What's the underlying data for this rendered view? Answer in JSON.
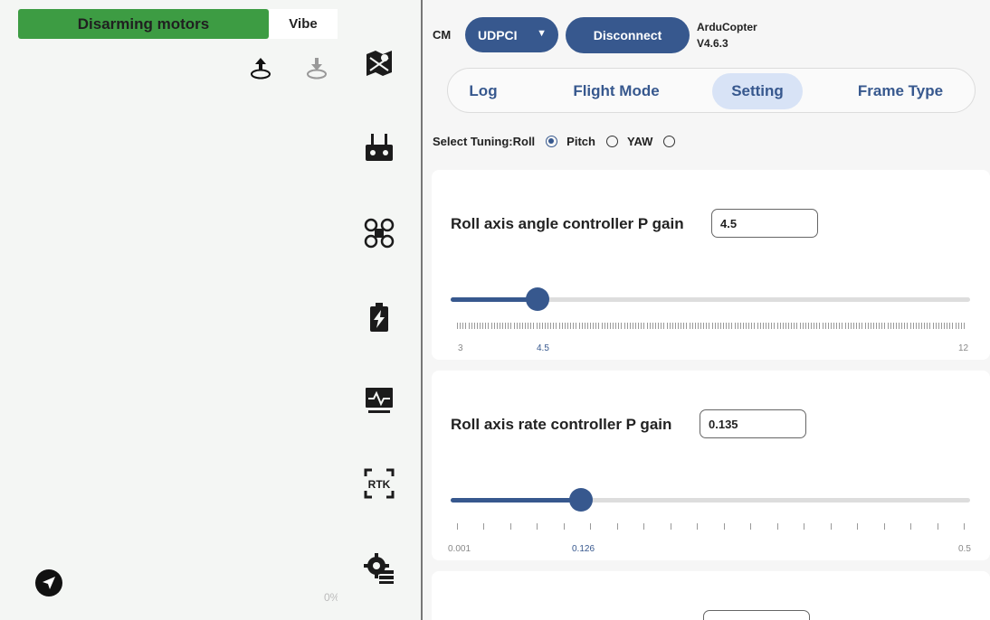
{
  "left_panel": {
    "status_label": "Disarming motors",
    "vibe_label": "Vibe",
    "percent_text": "0%",
    "icons": [
      "upload-mission-icon",
      "download-mission-icon",
      "send-icon"
    ]
  },
  "rail": {
    "icons": [
      "map-icon",
      "remote-controller-icon",
      "drone-frame-icon",
      "battery-icon",
      "monitor-icon",
      "rtk-icon",
      "settings-icon"
    ],
    "rtk_text": "RTK"
  },
  "header": {
    "cm_label": "CM",
    "connection_select": "UDPCI",
    "disconnect_label": "Disconnect",
    "firmware_name": "ArduCopter",
    "firmware_version": "V4.6.3"
  },
  "tabs": [
    {
      "label": "Log",
      "active": false
    },
    {
      "label": "Flight Mode",
      "active": false
    },
    {
      "label": "Setting",
      "active": true
    },
    {
      "label": "Frame Type",
      "active": false
    }
  ],
  "tuning": {
    "prefix": "Select Tuning:",
    "options": [
      {
        "label": "Roll",
        "selected": true
      },
      {
        "label": "Pitch",
        "selected": false
      },
      {
        "label": "YAW",
        "selected": false
      }
    ]
  },
  "params": [
    {
      "title": "Roll axis angle controller P gain",
      "value": "4.5",
      "min": "3",
      "max": "12",
      "current_label": "4.5",
      "fraction": 0.167,
      "tick_count": 180
    },
    {
      "title": "Roll axis rate controller P gain",
      "value": "0.135",
      "min": "0.001",
      "max": "0.5",
      "current_label": "0.126",
      "fraction": 0.25,
      "tick_count": 20
    }
  ],
  "colors": {
    "status_green": "#3d9c43",
    "accent_blue": "#37588e",
    "active_tab_bg": "#d8e3f6"
  }
}
